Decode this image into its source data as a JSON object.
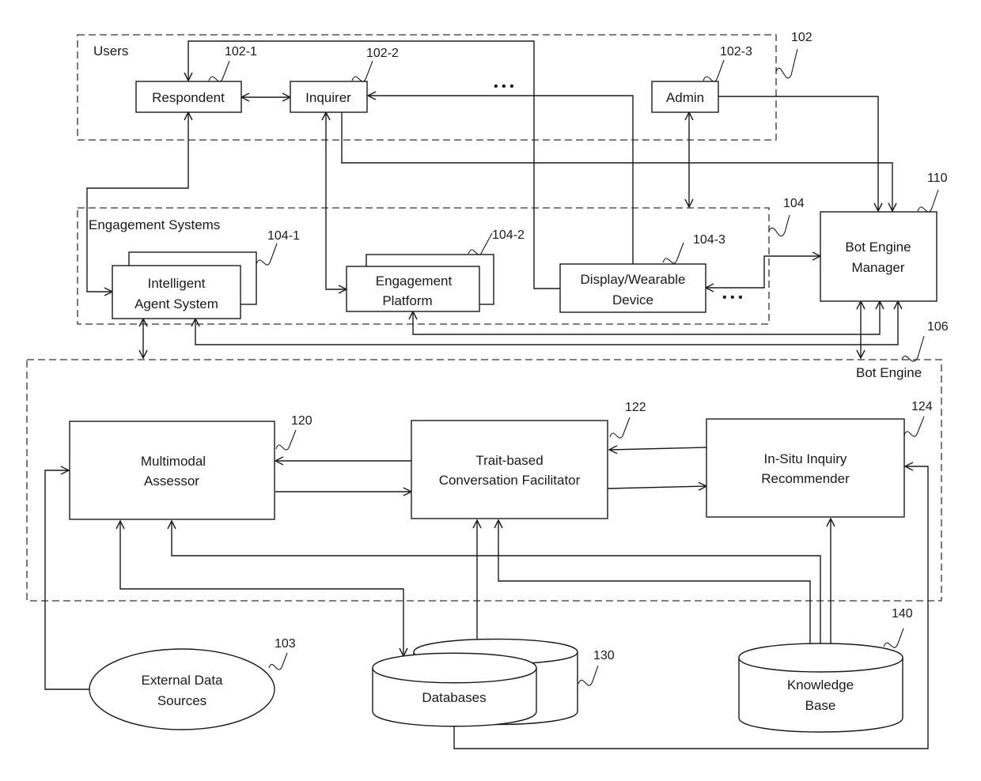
{
  "groups": {
    "users": {
      "label": "Users",
      "ref": "102"
    },
    "engagement": {
      "label": "Engagement Systems",
      "ref": "104"
    },
    "bot_engine": {
      "label": "Bot Engine",
      "ref": "106"
    }
  },
  "nodes": {
    "respondent": {
      "label": "Respondent",
      "ref": "102-1"
    },
    "inquirer": {
      "label": "Inquirer",
      "ref": "102-2"
    },
    "admin": {
      "label": "Admin",
      "ref": "102-3"
    },
    "intelligent_agent": {
      "line1": "Intelligent",
      "line2": "Agent System",
      "ref": "104-1"
    },
    "engagement_platform": {
      "line1": "Engagement",
      "line2": "Platform",
      "ref": "104-2"
    },
    "display_device": {
      "line1": "Display/Wearable",
      "line2": "Device",
      "ref": "104-3"
    },
    "bot_engine_manager": {
      "line1": "Bot Engine",
      "line2": "Manager",
      "ref": "110"
    },
    "multimodal_assessor": {
      "line1": "Multimodal",
      "line2": "Assessor",
      "ref": "120"
    },
    "conversation_facilitator": {
      "line1": "Trait-based",
      "line2": "Conversation Facilitator",
      "ref": "122"
    },
    "inquiry_recommender": {
      "line1": "In-Situ Inquiry",
      "line2": "Recommender",
      "ref": "124"
    },
    "external_data": {
      "line1": "External Data",
      "line2": "Sources",
      "ref": "103"
    },
    "databases": {
      "label": "Databases",
      "ref": "130"
    },
    "knowledge_base": {
      "line1": "Knowledge",
      "line2": "Base",
      "ref": "140"
    }
  },
  "ellipsis": "• • •"
}
